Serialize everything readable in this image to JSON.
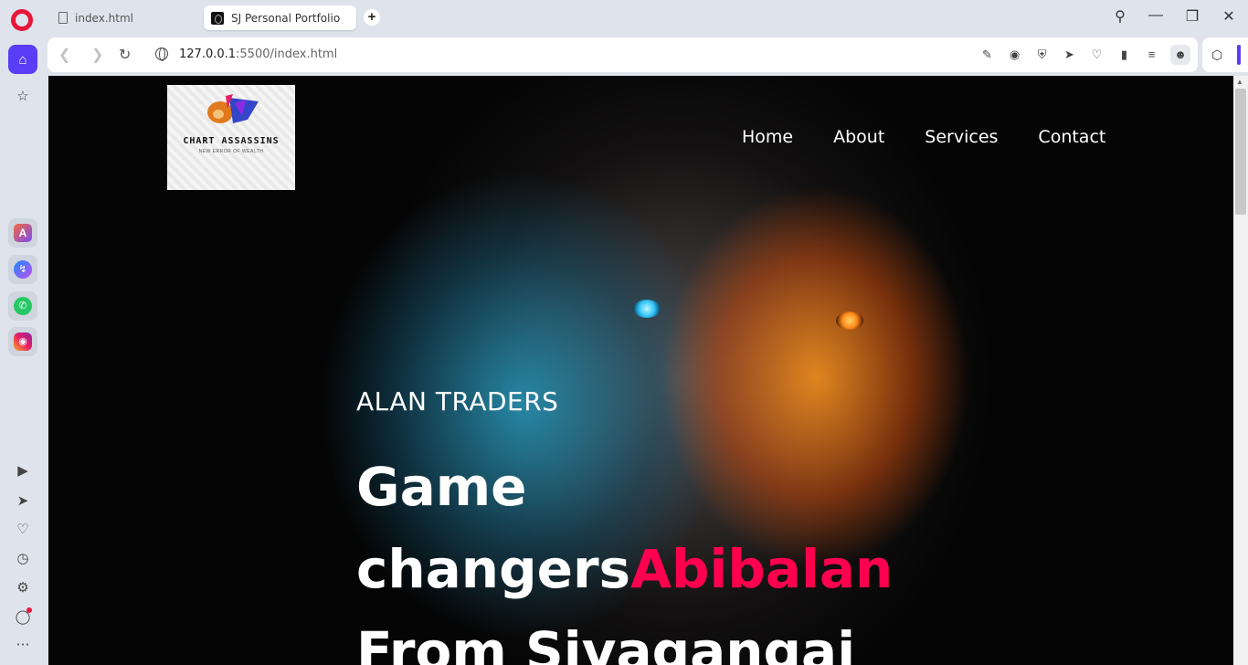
{
  "browser": {
    "tabs": [
      {
        "title": "index.html",
        "active": false
      },
      {
        "title": "SJ Personal Portfolio",
        "active": true
      }
    ],
    "url_host": "127.0.0.1",
    "url_path": ":5500/index.html",
    "accent_color": "#5b3df5",
    "brand_color": "#e8173a"
  },
  "site": {
    "logo_text": "CHART ASSASSINS",
    "logo_subtext": "NEW ERROR OF WEALTH",
    "nav": [
      "Home",
      "About",
      "Services",
      "Contact"
    ],
    "brand_line": "ALAN TRADERS",
    "hero_line1": "Game",
    "hero_line2": "changers",
    "hero_accent": "Abibalan",
    "hero_line3": "From Sivagangai",
    "accent_color": "#ff004f"
  }
}
